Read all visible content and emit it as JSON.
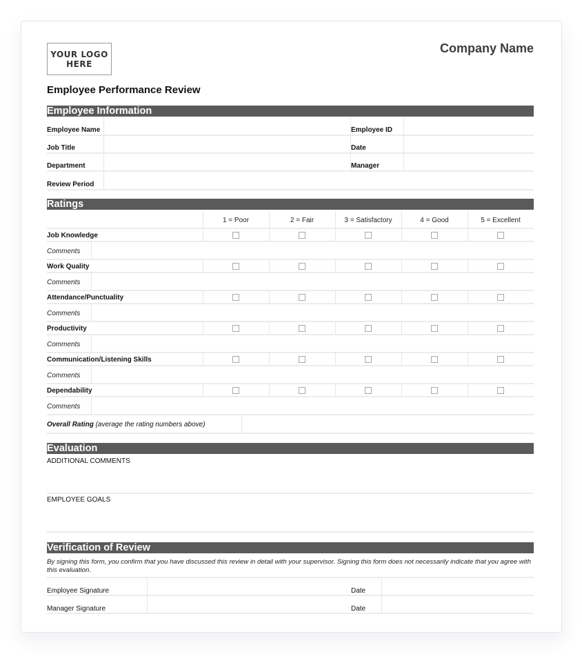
{
  "header": {
    "logo_text": "YOUR LOGO\nHERE",
    "company_name": "Company Name",
    "title": "Employee Performance Review"
  },
  "employee_information": {
    "section_title": "Employee Information",
    "left_fields": [
      {
        "label": "Employee Name",
        "value": ""
      },
      {
        "label": "Job Title",
        "value": ""
      },
      {
        "label": "Department",
        "value": ""
      },
      {
        "label": "Review Period",
        "value": ""
      }
    ],
    "right_fields": [
      {
        "label": "Employee ID",
        "value": ""
      },
      {
        "label": "Date",
        "value": ""
      },
      {
        "label": "Manager",
        "value": ""
      }
    ]
  },
  "ratings": {
    "section_title": "Ratings",
    "scale": [
      "1 = Poor",
      "2 = Fair",
      "3 = Satisfactory",
      "4 = Good",
      "5 = Excellent"
    ],
    "comments_label": "Comments",
    "criteria": [
      {
        "name": "Job Knowledge",
        "selected": null,
        "comments": ""
      },
      {
        "name": "Work Quality",
        "selected": null,
        "comments": ""
      },
      {
        "name": "Attendance/Punctuality",
        "selected": null,
        "comments": ""
      },
      {
        "name": "Productivity",
        "selected": null,
        "comments": ""
      },
      {
        "name": "Communication/Listening Skills",
        "selected": null,
        "comments": ""
      },
      {
        "name": "Dependability",
        "selected": null,
        "comments": ""
      }
    ],
    "overall_label_bold": "Overall Rating",
    "overall_label_note": " (average the rating numbers above)",
    "overall_value": ""
  },
  "evaluation": {
    "section_title": "Evaluation",
    "additional_comments_label": "ADDITIONAL COMMENTS",
    "additional_comments_value": "",
    "employee_goals_label": "EMPLOYEE GOALS",
    "employee_goals_value": ""
  },
  "verification": {
    "section_title": "Verification of Review",
    "disclaimer": "By signing this form, you confirm that you have discussed this review in detail with your supervisor. Signing this form does not necessarily indicate that you agree with this evaluation.",
    "signatures": [
      {
        "label": "Employee Signature",
        "date_label": "Date",
        "value": "",
        "date_value": ""
      },
      {
        "label": "Manager Signature",
        "date_label": "Date",
        "value": "",
        "date_value": ""
      }
    ]
  }
}
